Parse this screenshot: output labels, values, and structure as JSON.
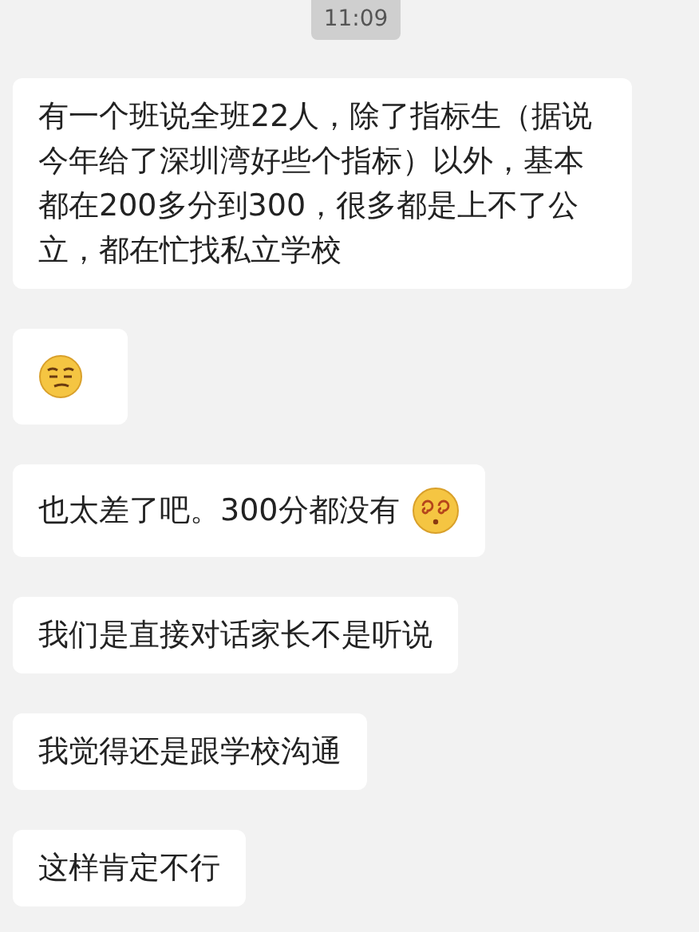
{
  "timestamp": "11:09",
  "messages": [
    {
      "kind": "text",
      "text": "有一个班说全班22人，除了指标生（据说今年给了深圳湾好些个指标）以外，基本都在200多分到300，很多都是上不了公立，都在忙找私立学校"
    },
    {
      "kind": "emoji"
    },
    {
      "kind": "text_emoji",
      "text": "也太差了吧。300分都没有"
    },
    {
      "kind": "text",
      "text": "我们是直接对话家长不是听说"
    },
    {
      "kind": "text",
      "text": "我觉得还是跟学校沟通"
    },
    {
      "kind": "text",
      "text": "这样肯定不行"
    }
  ]
}
